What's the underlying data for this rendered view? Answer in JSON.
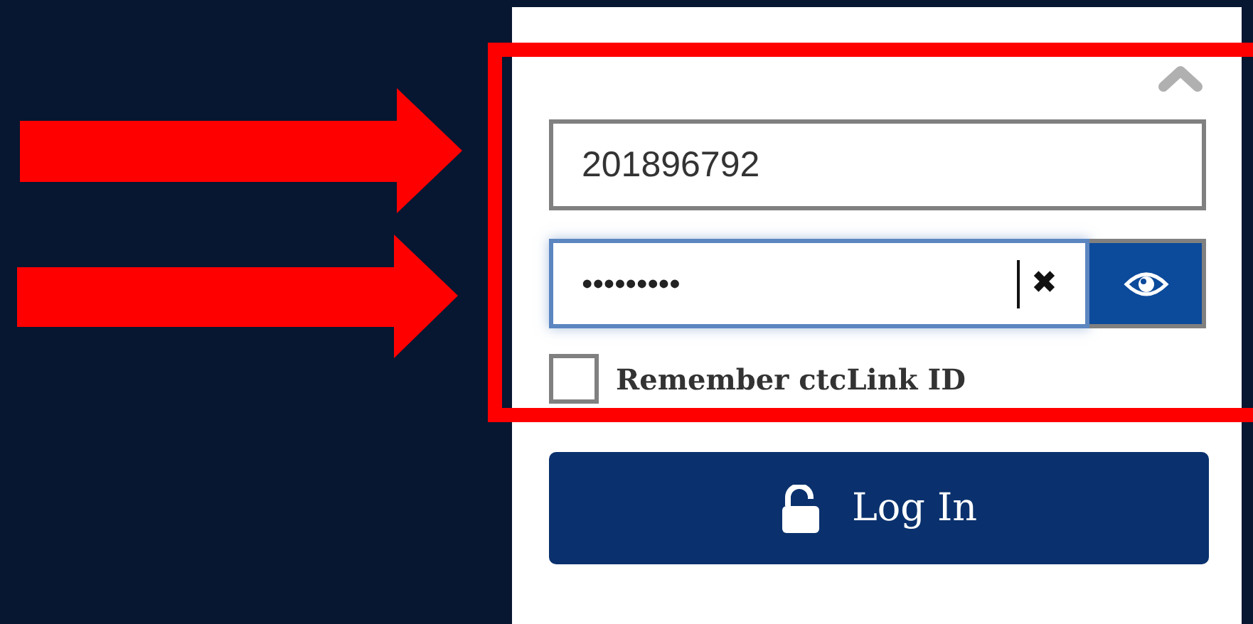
{
  "username_field": {
    "value": "201896792"
  },
  "password_field": {
    "value": "•••••••••",
    "focused": true,
    "clear_label": "✖"
  },
  "remember_checkbox": {
    "label": "Remember ctcLink ID",
    "checked": false
  },
  "login_button": {
    "label": "Log In"
  }
}
